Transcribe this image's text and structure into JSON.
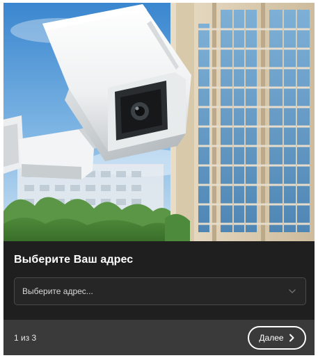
{
  "hero": {
    "image": "security-camera-apartment-building",
    "icon": "cctv-camera-icon"
  },
  "panel": {
    "title": "Выберите Ваш адрес",
    "address_select": {
      "placeholder": "Выберите адрес...",
      "icon": "chevron-down-icon"
    }
  },
  "footer": {
    "step": "1 из 3",
    "next_label": "Далее",
    "next_icon": "chevron-right-icon"
  },
  "colors": {
    "panel_bg": "#1f1f1f",
    "footer_bg": "#3a3a3a",
    "field_border": "#4a4a4a",
    "text": "#ffffff"
  }
}
